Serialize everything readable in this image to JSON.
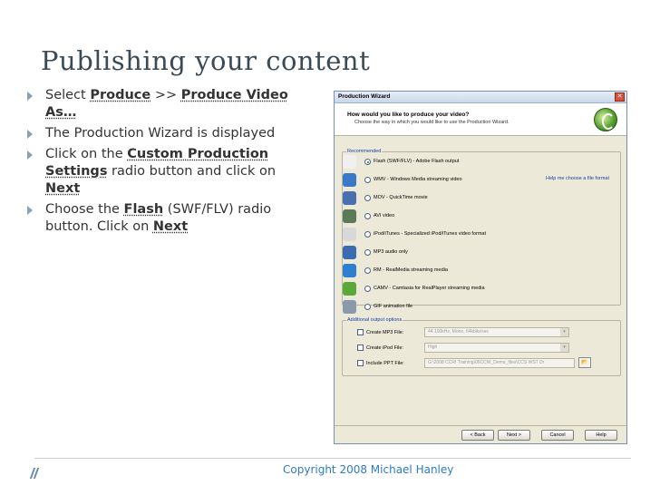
{
  "slide": {
    "title": "Publishing your content",
    "bullets": [
      {
        "parts": [
          {
            "t": "Select ",
            "b": false
          },
          {
            "t": "Produce",
            "b": true
          },
          {
            "t": " >> ",
            "b": false
          },
          {
            "t": "Produce Video As…",
            "b": true
          }
        ]
      },
      {
        "parts": [
          {
            "t": "The Production Wizard is displayed",
            "b": false
          }
        ]
      },
      {
        "parts": [
          {
            "t": "Click on the ",
            "b": false
          },
          {
            "t": "Custom Production Settings",
            "b": true
          },
          {
            "t": " radio button and click on ",
            "b": false
          },
          {
            "t": "Next",
            "b": true
          }
        ]
      },
      {
        "parts": [
          {
            "t": "Choose the ",
            "b": false
          },
          {
            "t": "Flash",
            "b": true
          },
          {
            "t": " (SWF/FLV) radio button. Click on ",
            "b": false
          },
          {
            "t": "Next",
            "b": true
          }
        ]
      }
    ],
    "copyright": "Copyright 2008 Michael Hanley"
  },
  "dialog": {
    "title": "Production Wizard",
    "close_label": "✕",
    "question": "How would you like to produce your video?",
    "subtitle": "Choose the way in which you would like to use the Production Wizard.",
    "recommended_label": "Recommended",
    "options": [
      {
        "label": "Flash (SWF/FLV) - Adobe Flash output",
        "icon": "flash-icon",
        "color": "#f0f0f0",
        "selected": true
      },
      {
        "label": "WMV - Windows Media streaming video",
        "icon": "windows-media-icon",
        "color": "#3a78c8",
        "selected": false
      },
      {
        "label": "MOV - QuickTime movie",
        "icon": "quicktime-icon",
        "color": "#4a6fb0",
        "selected": false
      },
      {
        "label": "AVI video",
        "icon": "avi-icon",
        "color": "#5a7a5a",
        "selected": false
      },
      {
        "label": "iPod/iTunes - Specialized iPod/iTunes video format",
        "icon": "ipod-icon",
        "color": "#d8d8d8",
        "selected": false
      },
      {
        "label": "MP3 audio only",
        "icon": "mp3-icon",
        "color": "#3b6cb0",
        "selected": false
      },
      {
        "label": "RM - RealMedia streaming media",
        "icon": "realmedia-icon",
        "color": "#2f7fd0",
        "selected": false
      },
      {
        "label": "CAMV - Camtasia for RealPlayer streaming media",
        "icon": "camtasia-icon",
        "color": "#5aa83a",
        "selected": false
      },
      {
        "label": "GIF animation file",
        "icon": "gif-icon",
        "color": "#8a9aaa",
        "selected": false
      }
    ],
    "help_link": "Help me choose a file format",
    "additional_label": "Additional output options",
    "additional": [
      {
        "label": "Create MP3 File:",
        "value": "44.100kHz, Mono, 64kbits/sec",
        "kind": "select"
      },
      {
        "label": "Create iPod File:",
        "value": "High",
        "kind": "select"
      },
      {
        "label": "Include PPT File:",
        "value": "G:\\2008 CCRI Training\\05CCW_Demo_files\\CCS WST Dr",
        "kind": "browse"
      }
    ],
    "buttons": {
      "back": "< Back",
      "next": "Next >",
      "cancel": "Cancel",
      "help": "Help"
    }
  }
}
